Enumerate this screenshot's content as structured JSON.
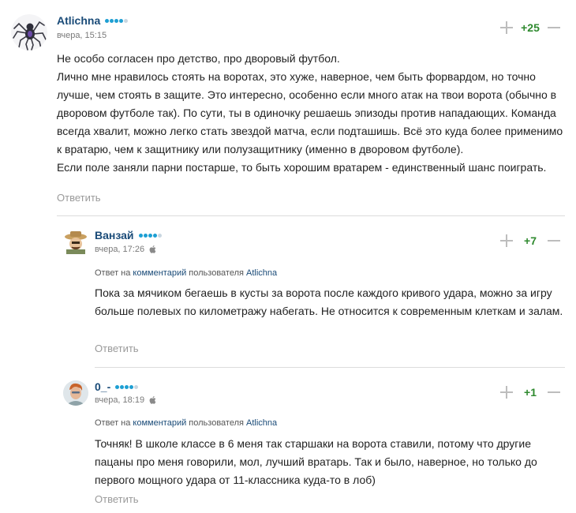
{
  "comments": [
    {
      "author": "Atlichna",
      "rating_level": 4,
      "time": "вчера, 15:15",
      "score": "+25",
      "paragraphs": [
        "Не особо согласен про детство, про дворовый футбол.",
        "Лично мне нравилось стоять на воротах, это хуже, наверное, чем быть форвардом, но точно лучше, чем стоять в защите. Это интересно, особенно если много атак на твои ворота (обычно в дворовом футболе так). По сути, ты в одиночку решаешь эпизоды против нападающих. Команда всегда хвалит, можно легко стать звездой матча, если подташишь. Всё это куда более применимо к вратарю, чем к защитнику или полузащитнику (именно в дворовом футболе).",
        "Если поле заняли парни постарше, то быть хорошим вратарем - единственный шанс поиграть."
      ],
      "reply_label": "Ответить"
    },
    {
      "author": "Ванзай",
      "rating_level": 4,
      "time": "вчера, 17:26",
      "device_icon": "apple-icon",
      "score": "+7",
      "reply_to": {
        "prefix": "Ответ на",
        "link": "комментарий",
        "middle": "пользователя",
        "user": "Atlichna"
      },
      "paragraphs": [
        "Пока за мячиком бегаешь в кусты за ворота после каждого кривого удара, можно за игру больше полевых по километражу набегать. Не относится к современным клеткам и залам."
      ],
      "reply_label": "Ответить"
    },
    {
      "author": "0_-",
      "rating_level": 4,
      "time": "вчера, 18:19",
      "device_icon": "apple-icon",
      "score": "+1",
      "reply_to": {
        "prefix": "Ответ на",
        "link": "комментарий",
        "middle": "пользователя",
        "user": "Atlichna"
      },
      "paragraphs": [
        "Точняк! В школе классе в 6 меня так старшаки на ворота ставили, потому что другие пацаны про меня говорили, мол, лучший вратарь. Так и было, наверное, но только до первого мощного удара от 11-классника куда-то в лоб)"
      ],
      "reply_label": "Ответить"
    }
  ],
  "colors": {
    "author": "#1a4b78",
    "rating_on": "#1d9fd3",
    "rating_off": "#c8d6e0",
    "score_positive": "#2f8a2f",
    "muted": "#9a9a9a"
  }
}
